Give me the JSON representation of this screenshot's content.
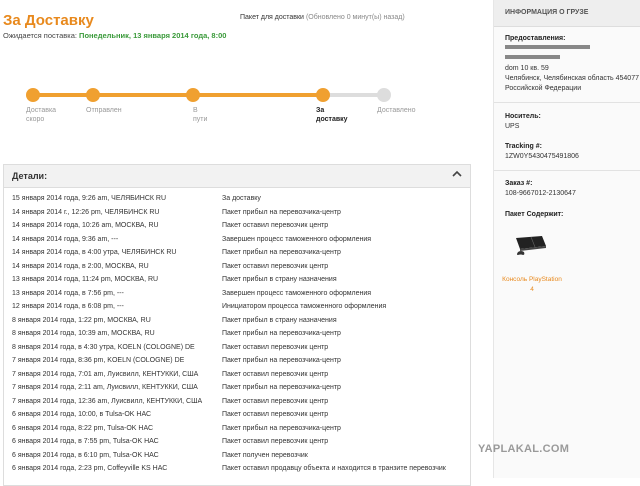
{
  "header": {
    "title": "За Доставку",
    "package_label": "Пакет для доставки",
    "updated": "(Обновлено 0 минут(ы) назад)",
    "expected_label": "Ожидается поставка:",
    "expected_date": "Понедельник, 13 января 2014 года, 8:00"
  },
  "progress": {
    "current_step": 4,
    "steps": [
      {
        "label_1": "Доставка",
        "label_2": "скоро"
      },
      {
        "label_1": "Отправлен",
        "label_2": ""
      },
      {
        "label_1": "В",
        "label_2": "пути"
      },
      {
        "label_1": "За",
        "label_2": "доставку"
      },
      {
        "label_1": "Доставлено",
        "label_2": ""
      }
    ]
  },
  "details": {
    "title": "Детали:",
    "rows": [
      {
        "when": "15 января 2014 года, 9:26 am, ЧЕЛЯБИНСК RU",
        "event": "За доставку"
      },
      {
        "when": "14 января 2014 г., 12:26 pm, ЧЕЛЯБИНСК RU",
        "event": "Пакет прибыл на перевозчика-центр"
      },
      {
        "when": "14 января 2014 года, 10:26 am, МОСКВА, RU",
        "event": "Пакет оставил перевозчик центр"
      },
      {
        "when": "14 января 2014 года, 9:36 am, ---",
        "event": "Завершен процесс таможенного оформления"
      },
      {
        "when": "14 января 2014 года, в 4:00 утра, ЧЕЛЯБИНСК RU",
        "event": "Пакет прибыл на перевозчика-центр"
      },
      {
        "when": "14 января 2014 года, в 2:00, МОСКВА, RU",
        "event": "Пакет оставил перевозчик центр"
      },
      {
        "when": "13 января 2014 года, 11:24 pm, МОСКВА, RU",
        "event": "Пакет прибыл в страну назначения"
      },
      {
        "when": "13 января 2014 года, в 7:56 pm, ---",
        "event": "Завершен процесс таможенного оформления"
      },
      {
        "when": "12 января 2014 года, в 6:08 pm, ---",
        "event": "Инициатором процесса таможенного оформления"
      },
      {
        "when": "8 января 2014 года, 1:22 pm, МОСКВА, RU",
        "event": "Пакет прибыл в страну назначения"
      },
      {
        "when": "8 января 2014 года, 10:39 am, МОСКВА, RU",
        "event": "Пакет прибыл на перевозчика-центр"
      },
      {
        "when": "8 января 2014 года, в 4:30 утра, KOELN (COLOGNE) DE",
        "event": "Пакет оставил перевозчик центр"
      },
      {
        "when": "7 января 2014 года, 8:36 pm, KOELN (COLOGNE) DE",
        "event": "Пакет прибыл на перевозчика-центр"
      },
      {
        "when": "7 января 2014 года, 7:01 am, Луисвилл, КЕНТУККИ, США",
        "event": "Пакет оставил перевозчик центр"
      },
      {
        "when": "7 января 2014 года, 2:11 am, Луисвилл, КЕНТУККИ, США",
        "event": "Пакет прибыл на перевозчика-центр"
      },
      {
        "when": "7 января 2014 года, 12:36 am, Луисвилл, КЕНТУККИ, США",
        "event": "Пакет оставил перевозчик центр"
      },
      {
        "when": "6 января 2014 года, 10:00, в Tulsa-OK НАС",
        "event": "Пакет оставил перевозчик центр"
      },
      {
        "when": "6 января 2014 года, 8:22 pm, Tulsa-OK НАС",
        "event": "Пакет прибыл на перевозчика-центр"
      },
      {
        "when": "6 января 2014 года, в 7:55 pm, Tulsa-OK НАС",
        "event": "Пакет оставил перевозчик центр"
      },
      {
        "when": "6 января 2014 года, в 6:10 pm, Tulsa-OK НАС",
        "event": "Пакет получен перевозчик"
      },
      {
        "when": "6 января 2014 года, 2:23 pm, Coffeyville KS НАС",
        "event": "Пакет оставил продавцу объекта и находится в транзите перевозчик"
      }
    ]
  },
  "sidebar": {
    "title": "ИНФОРМАЦИЯ О ГРУЗЕ",
    "provided_label": "Предоставления:",
    "address_1": "dom 10 кв. 59",
    "address_2": "Челябинск, Челябинская область 454077",
    "address_3": "Российской Федерации",
    "carrier_label": "Носитель:",
    "carrier": "UPS",
    "tracking_label": "Tracking #:",
    "tracking": "1ZW0Y5430475491806",
    "order_label": "Заказ #:",
    "order": "108-9667012-2130647",
    "contents_label": "Пакет Содержит:",
    "product_name": "Консоль PlayStation",
    "product_qty": "4"
  },
  "watermark": "YAPLAKAL.COM",
  "colors": {
    "accent": "#e8891d",
    "progress": "#f0a030",
    "green": "#3a9a3a"
  }
}
